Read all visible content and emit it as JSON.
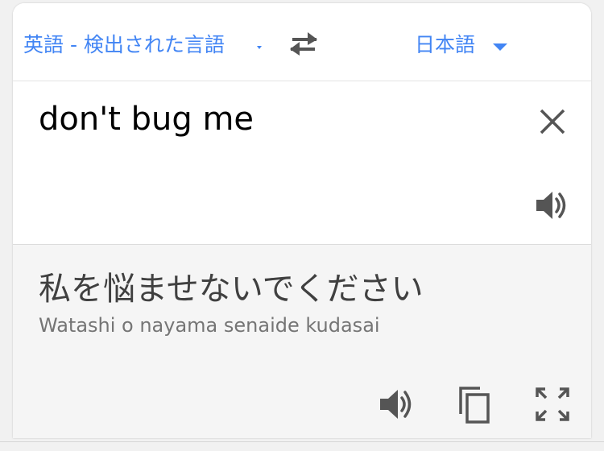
{
  "language_bar": {
    "source_language": "英語 - 検出された言語",
    "target_language": "日本語"
  },
  "input": {
    "text": "don't bug me"
  },
  "output": {
    "translation": "私を悩ませないでください",
    "romanization": "Watashi o nayama senaide kudasai"
  },
  "icons": {
    "swap": "swap-arrows-icon",
    "clear": "close-icon",
    "listen_source": "speaker-icon",
    "listen_translation": "speaker-icon",
    "copy": "copy-icon",
    "fullscreen": "fullscreen-icon"
  },
  "colors": {
    "accent": "#4285f4",
    "icon": "#555555",
    "output_background": "#f5f5f5"
  }
}
